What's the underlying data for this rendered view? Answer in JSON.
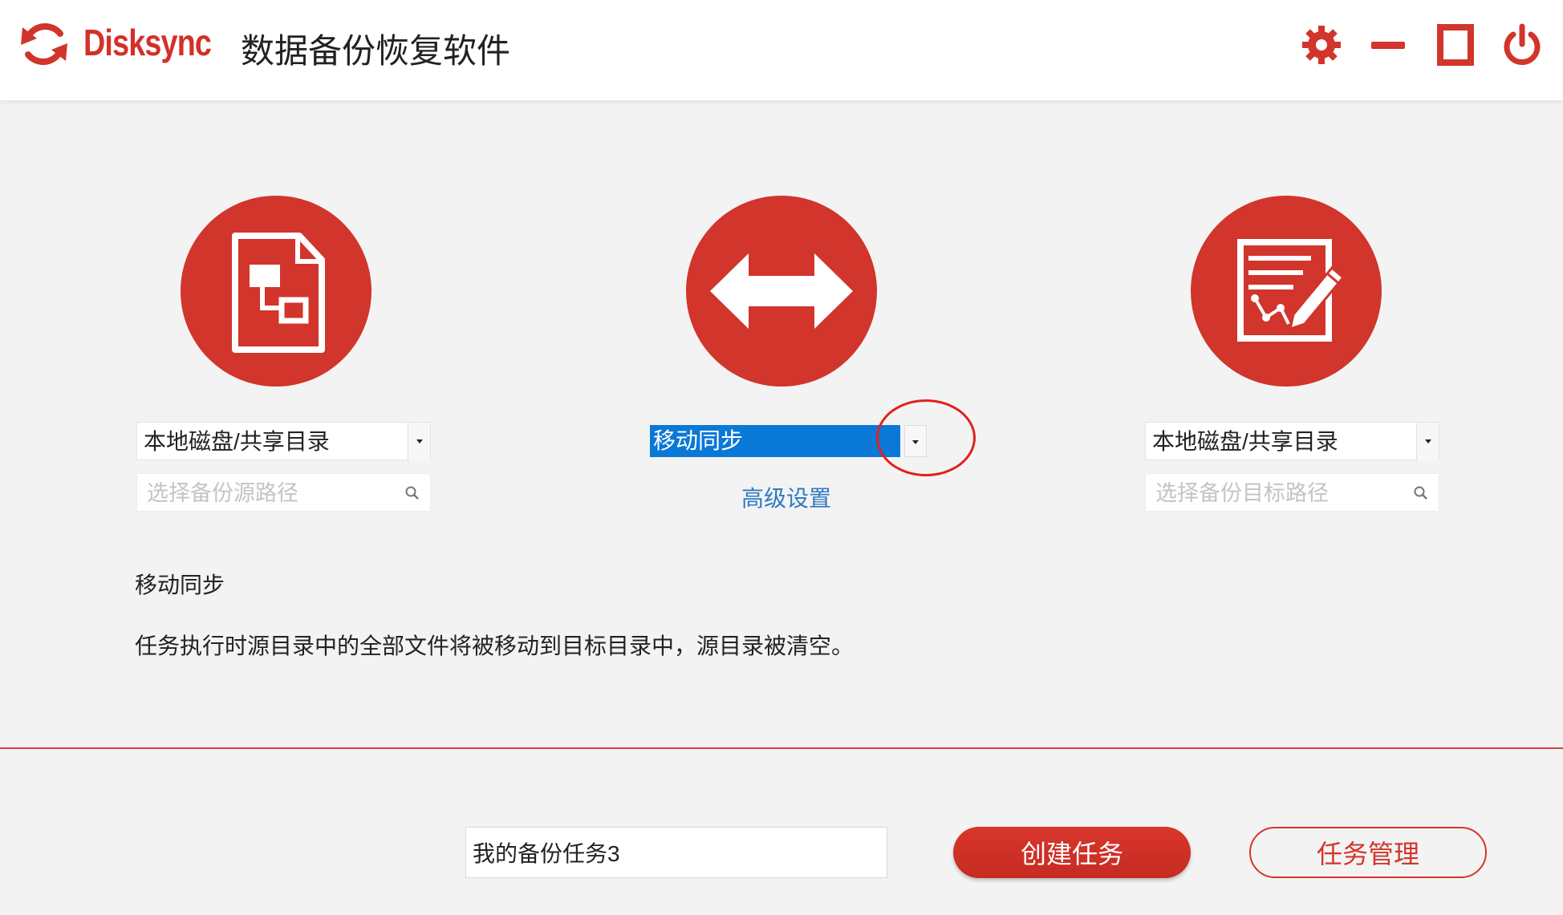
{
  "header": {
    "brand": "Disksync",
    "title": "数据备份恢复软件",
    "icons": [
      "sync-logo-icon",
      "gear-icon",
      "minimize-icon",
      "maximize-icon",
      "power-icon"
    ]
  },
  "source": {
    "icon": "source-file-icon",
    "type_value": "本地磁盘/共享目录",
    "path_placeholder": "选择备份源路径"
  },
  "mode": {
    "icon": "bidirectional-arrow-icon",
    "value": "移动同步",
    "advanced_link": "高级设置"
  },
  "target": {
    "icon": "target-edit-icon",
    "type_value": "本地磁盘/共享目录",
    "path_placeholder": "选择备份目标路径"
  },
  "description": {
    "title": "移动同步",
    "text": "任务执行时源目录中的全部文件将被移动到目标目录中，源目录被清空。"
  },
  "footer": {
    "task_name_value": "我的备份任务3",
    "create_button": "创建任务",
    "manage_button": "任务管理"
  },
  "colors": {
    "accent": "#d1352b",
    "link": "#2f79c4",
    "selection": "#0a78d7",
    "background": "#f3f3f3"
  }
}
